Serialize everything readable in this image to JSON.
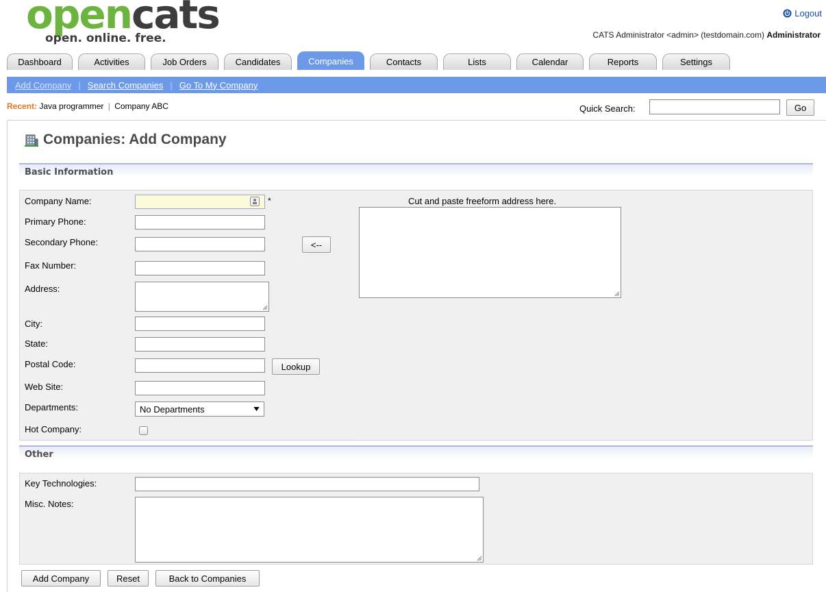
{
  "header": {
    "logo_open": "open",
    "logo_cats": "cats",
    "logo_tagline": "open. online. free.",
    "logout_label": "Logout",
    "user_text": "CATS Administrator <admin> (testdomain.com)",
    "user_role": "Administrator"
  },
  "tabs": [
    "Dashboard",
    "Activities",
    "Job Orders",
    "Candidates",
    "Companies",
    "Contacts",
    "Lists",
    "Calendar",
    "Reports",
    "Settings"
  ],
  "active_tab": "Companies",
  "subnav": {
    "add_company": "Add Company",
    "search_companies": "Search Companies",
    "go_to_my_company": "Go To My Company",
    "separator": "|"
  },
  "recent": {
    "label": "Recent:",
    "items": [
      "Java programmer",
      "Company ABC"
    ],
    "separator": "|"
  },
  "quick_search": {
    "label": "Quick Search:",
    "value": "",
    "button": "Go"
  },
  "page": {
    "title": "Companies: Add Company"
  },
  "basic_info": {
    "header": "Basic Information",
    "company_name": {
      "label": "Company Name:",
      "value": "",
      "required_mark": "*"
    },
    "primary_phone": {
      "label": "Primary Phone:",
      "value": ""
    },
    "secondary_phone": {
      "label": "Secondary Phone:",
      "value": ""
    },
    "fax_number": {
      "label": "Fax Number:",
      "value": ""
    },
    "address": {
      "label": "Address:",
      "value": ""
    },
    "city": {
      "label": "City:",
      "value": ""
    },
    "state": {
      "label": "State:",
      "value": ""
    },
    "postal_code": {
      "label": "Postal Code:",
      "value": "",
      "lookup_button": "Lookup"
    },
    "web_site": {
      "label": "Web Site:",
      "value": ""
    },
    "departments": {
      "label": "Departments:",
      "selected": "No Departments"
    },
    "hot_company": {
      "label": "Hot Company:",
      "checked": false
    },
    "parse_button": "<--",
    "freeform_label": "Cut and paste freeform address here."
  },
  "other": {
    "header": "Other",
    "key_technologies": {
      "label": "Key Technologies:",
      "value": ""
    },
    "misc_notes": {
      "label": "Misc. Notes:",
      "value": ""
    }
  },
  "actions": {
    "add_company": "Add Company",
    "reset": "Reset",
    "back_to_companies": "Back to Companies"
  },
  "colors": {
    "brand_green": "#6cb33f",
    "brand_dark": "#3d3d3d",
    "nav_blue": "#6c9ae9",
    "link_blue": "#1a4fa3",
    "recent_orange": "#e4761c",
    "panel_bg": "#f0f0f0",
    "highlight_input": "#fbfbd9"
  },
  "icons": {
    "logout": "power-icon",
    "title": "building-icon",
    "company_name_field": "contact-card-icon",
    "select_arrow": "triangle-down-icon"
  }
}
